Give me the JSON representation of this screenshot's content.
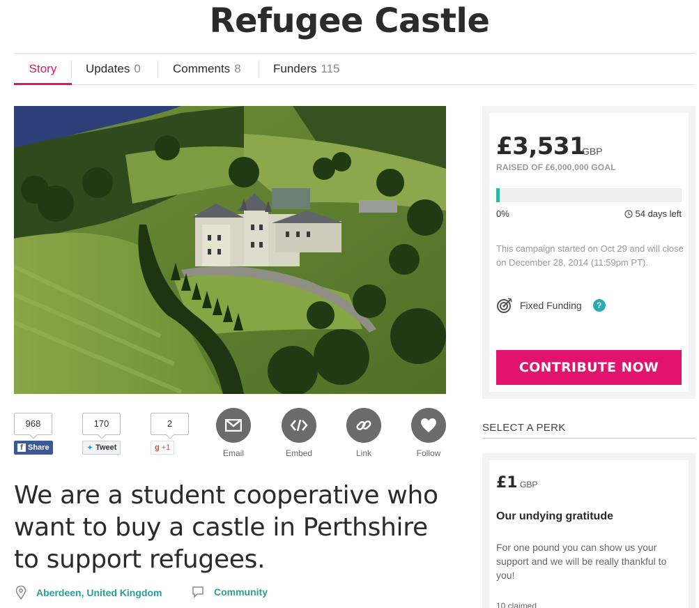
{
  "page": {
    "title": "Refugee Castle"
  },
  "tabs": [
    {
      "label": "Story",
      "count": ""
    },
    {
      "label": "Updates",
      "count": "0"
    },
    {
      "label": "Comments",
      "count": "8"
    },
    {
      "label": "Funders",
      "count": "115"
    }
  ],
  "social": {
    "facebook": {
      "count": "968",
      "label": "Share"
    },
    "twitter": {
      "count": "170",
      "label": "Tweet"
    },
    "google": {
      "count": "2",
      "label": "+1"
    }
  },
  "actions": {
    "email": "Email",
    "embed": "Embed",
    "link": "Link",
    "follow": "Follow"
  },
  "tagline": "We are a student cooperative who want to buy a castle in Perthshire to support refugees.",
  "meta": {
    "location": "Aberdeen, United Kingdom",
    "category": "Community"
  },
  "campaign": {
    "amount": "£3,531",
    "currency": "GBP",
    "raised_label": "RAISED OF £6,000,000 GOAL",
    "progress_fraction": 0.0006,
    "percent_label": "0%",
    "days_left": "54 days left",
    "description": "This campaign started on Oct 29 and will close on December 28, 2014 (11:59pm PT).",
    "funding_type": "Fixed Funding",
    "help": "?",
    "cta": "CONTRIBUTE NOW"
  },
  "perks": {
    "heading": "SELECT A PERK",
    "items": [
      {
        "amount": "£1",
        "currency": "GBP",
        "title": "Our undying gratitude",
        "description": "For one pound you can show us your support and we will be really thankful to you!",
        "claimed": "10 claimed"
      }
    ]
  },
  "colors": {
    "accent": "#e2136e",
    "teal": "#2bb5a0",
    "link": "#2a9d9a"
  }
}
